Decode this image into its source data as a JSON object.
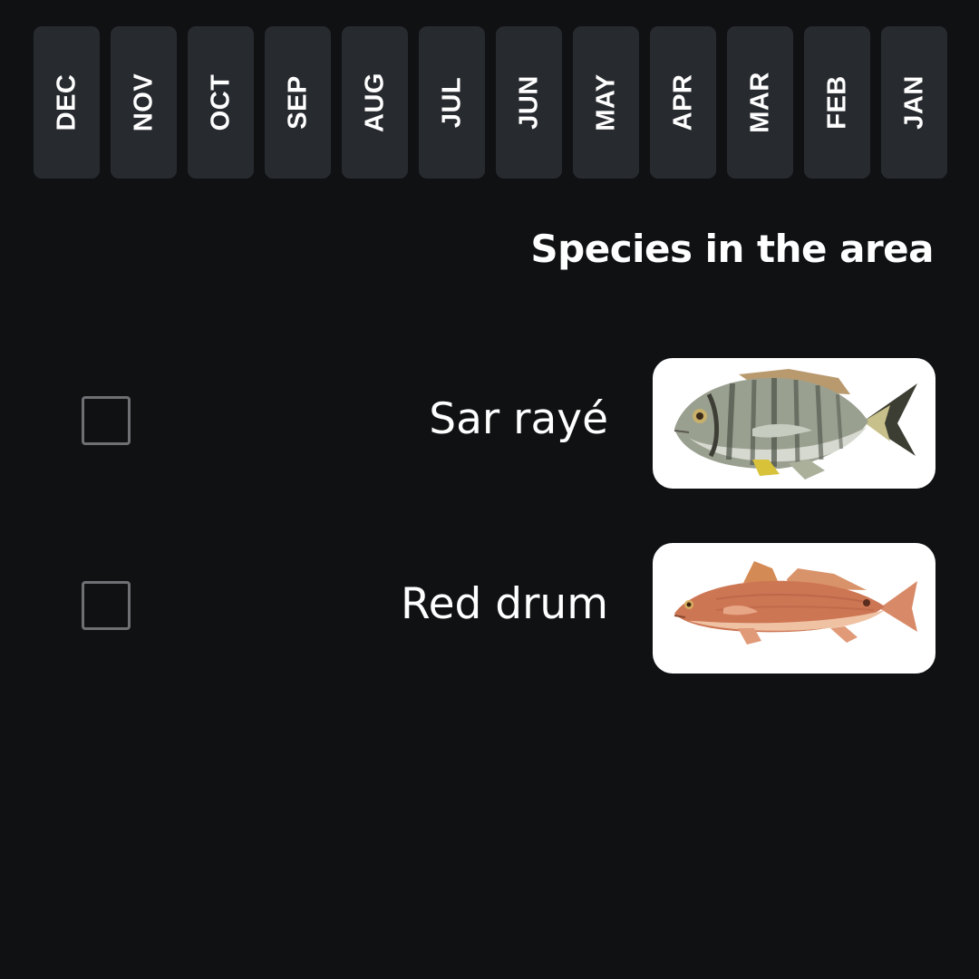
{
  "months": [
    "DEC",
    "NOV",
    "OCT",
    "SEP",
    "AUG",
    "JUL",
    "JUN",
    "MAY",
    "APR",
    "MAR",
    "FEB",
    "JAN"
  ],
  "section_title": "Species in the area",
  "species": [
    {
      "name": "Sar rayé",
      "checked": false,
      "image": "striped-seabream-illustration"
    },
    {
      "name": "Red drum",
      "checked": false,
      "image": "red-drum-illustration"
    }
  ],
  "colors": {
    "background": "#0f1113",
    "month_tile": "#272a2f",
    "text": "#ffffff",
    "checkbox_border": "#6e7074",
    "card": "#ffffff"
  }
}
